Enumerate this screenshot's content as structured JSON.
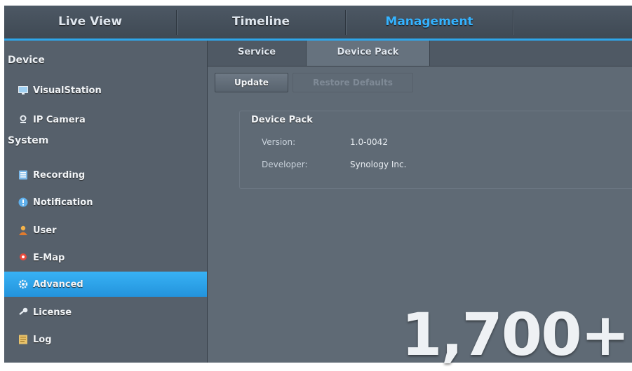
{
  "top_tabs": [
    {
      "label": "Live View"
    },
    {
      "label": "Timeline"
    },
    {
      "label": "Management"
    }
  ],
  "sidebar": {
    "sections": [
      {
        "label": "Device"
      },
      {
        "label": "System"
      }
    ],
    "items": [
      {
        "label": "IP Camera",
        "icon": "camera-icon"
      },
      {
        "label": "VisualStation",
        "icon": "monitor-icon"
      },
      {
        "label": "Recording",
        "icon": "recording-icon"
      },
      {
        "label": "Notification",
        "icon": "notification-icon"
      },
      {
        "label": "User",
        "icon": "user-icon"
      },
      {
        "label": "E-Map",
        "icon": "map-pin-icon"
      },
      {
        "label": "Advanced",
        "icon": "gear-icon"
      },
      {
        "label": "License",
        "icon": "key-icon"
      },
      {
        "label": "Log",
        "icon": "log-icon"
      }
    ],
    "active_item": "Advanced"
  },
  "content": {
    "tabs": [
      {
        "label": "Service"
      },
      {
        "label": "Device Pack"
      }
    ],
    "active_tab": "Device Pack",
    "buttons": {
      "update": "Update",
      "restore_defaults": "Restore Defaults"
    },
    "group": {
      "title": "Device Pack",
      "version_label": "Version:",
      "version_value": "1.0-0042",
      "developer_label": "Developer:",
      "developer_value": "Synology Inc."
    }
  },
  "overlay": {
    "big_number": "1,700+"
  },
  "colors": {
    "accent": "#2ea6ea",
    "active_tab_text": "#35b3ff",
    "background": "#5f6a75"
  }
}
